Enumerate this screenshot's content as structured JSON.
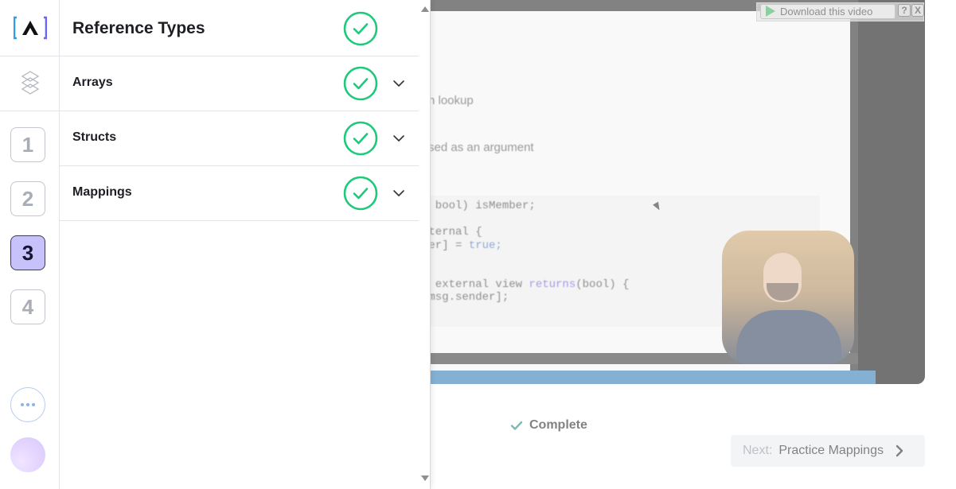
{
  "background": {
    "video": {
      "slide_lines": [
        "n lookup",
        "sed as an argument"
      ],
      "code_lines": [
        {
          "text": "- bool) isMember;"
        },
        {
          "text": "xternal {"
        },
        {
          "text": "der] = ",
          "kw": "true;"
        },
        {
          "text": ") external view ",
          "kw": "returns",
          "tail": "(bool) {"
        },
        {
          "text": "[msg.sender];"
        }
      ],
      "download_label": "Download this video",
      "help_label": "?",
      "close_label": "X"
    },
    "complete_label": "Complete",
    "next": {
      "prefix": "Next:",
      "title": "Practice Mappings"
    }
  },
  "drawer": {
    "title": "Reference Types",
    "sections": [
      {
        "label": "Arrays",
        "complete": true
      },
      {
        "label": "Structs",
        "complete": true
      },
      {
        "label": "Mappings",
        "complete": true
      }
    ],
    "steps": [
      "1",
      "2",
      "3",
      "4"
    ],
    "active_step": "3"
  },
  "colors": {
    "check_green": "#1ec97b",
    "active_step_bg": "#c8c2fb",
    "logo_blue": "#2f9ee8",
    "logo_purple": "#6c63ff"
  },
  "icons": {
    "logo": "bracketed-a-logo-icon",
    "chain": "hex-chain-icon",
    "check": "check-circle-icon",
    "expand": "chevron-down-icon",
    "more": "ellipsis-icon",
    "next": "chevron-right-icon"
  }
}
